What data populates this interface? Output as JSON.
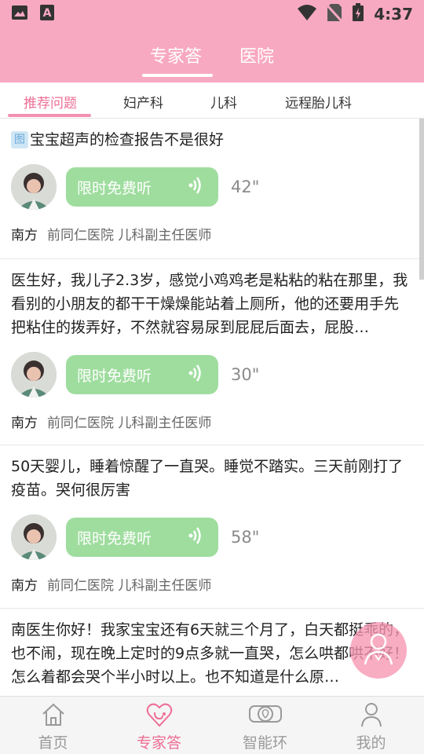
{
  "status_bar": {
    "time": "4:37",
    "icons": [
      "image-icon",
      "a-text-icon",
      "wifi-icon",
      "no-sim-icon",
      "battery-icon"
    ]
  },
  "header": {
    "tabs": [
      {
        "label": "专家答",
        "active": true
      },
      {
        "label": "医院",
        "active": false
      }
    ]
  },
  "subtabs": [
    {
      "label": "推荐问题",
      "active": true
    },
    {
      "label": "妇产科",
      "active": false
    },
    {
      "label": "儿科",
      "active": false
    },
    {
      "label": "远程胎儿科",
      "active": false
    }
  ],
  "questions": [
    {
      "tag": "图",
      "text": "宝宝超声的检查报告不是很好",
      "voice_label": "限时免费听",
      "duration": "42\"",
      "doctor_name": "南方",
      "doctor_title": "前同仁医院 儿科副主任医师"
    },
    {
      "text": "医生好，我儿子2.3岁，感觉小鸡鸡老是粘粘的粘在那里，我看别的小朋友的都干干燥燥能站着上厕所，他的还要用手先把粘住的拨弄好，不然就容易尿到屁屁后面去，屁股…",
      "voice_label": "限时免费听",
      "duration": "30\"",
      "doctor_name": "南方",
      "doctor_title": "前同仁医院 儿科副主任医师"
    },
    {
      "text": "50天婴儿，睡着惊醒了一直哭。睡觉不踏实。三天前刚打了疫苗。哭何很厉害",
      "voice_label": "限时免费听",
      "duration": "58\"",
      "doctor_name": "南方",
      "doctor_title": "前同仁医院 儿科副主任医师"
    },
    {
      "text": "南医生你好！我家宝宝还有6天就三个月了，白天都挺乖的，也不闹，现在晚上定时的9点多就一直哭，怎么哄都哄不好！怎么着都会哭个半小时以上。也不知道是什么原…"
    }
  ],
  "bottom_nav": [
    {
      "label": "首页",
      "icon": "home-icon",
      "active": false
    },
    {
      "label": "专家答",
      "icon": "heart-stethoscope-icon",
      "active": true
    },
    {
      "label": "智能环",
      "icon": "smart-ring-icon",
      "active": false
    },
    {
      "label": "我的",
      "icon": "person-icon",
      "active": false
    }
  ],
  "colors": {
    "header_pink": "#f8a9c2",
    "accent_pink": "#ee6e95",
    "voice_green": "#9fdd9f"
  }
}
